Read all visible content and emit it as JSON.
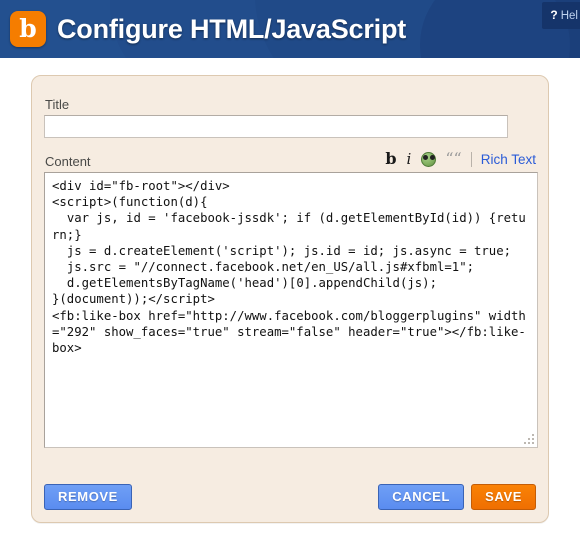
{
  "header": {
    "logo_alt": "blogger-logo",
    "logo_letter": "b",
    "title": "Configure HTML/JavaScript",
    "help_marker": "?",
    "help_label": "Hel",
    "bg_color": "#1b3f7a",
    "logo_color": "#f57d00"
  },
  "form": {
    "title_label": "Title",
    "title_value": "",
    "title_placeholder": "",
    "content_label": "Content",
    "content_value": "<div id=\"fb-root\"></div>\n<script>(function(d){\n  var js, id = 'facebook-jssdk'; if (d.getElementById(id)) {return;}\n  js = d.createElement('script'); js.id = id; js.async = true;\n  js.src = \"//connect.facebook.net/en_US/all.js#xfbml=1\";\n  d.getElementsByTagName('head')[0].appendChild(js);\n}(document));</script>\n<fb:like-box href=\"http://www.facebook.com/bloggerplugins\" width=\"292\" show_faces=\"true\" stream=\"false\" header=\"true\"></fb:like-box>"
  },
  "toolbar": {
    "bold_label": "b",
    "italic_label": "i",
    "emoticon_name": "emoticon-icon",
    "quote_label": "“",
    "rich_text_label": "Rich Text",
    "link_color": "#2a5bd7"
  },
  "buttons": {
    "remove_label": "REMOVE",
    "cancel_label": "CANCEL",
    "save_label": "SAVE",
    "blue_color": "#5a8cf0",
    "orange_color": "#f57d00"
  },
  "panel": {
    "background_color": "#f6ece1",
    "border_color": "#ddc9b0"
  }
}
